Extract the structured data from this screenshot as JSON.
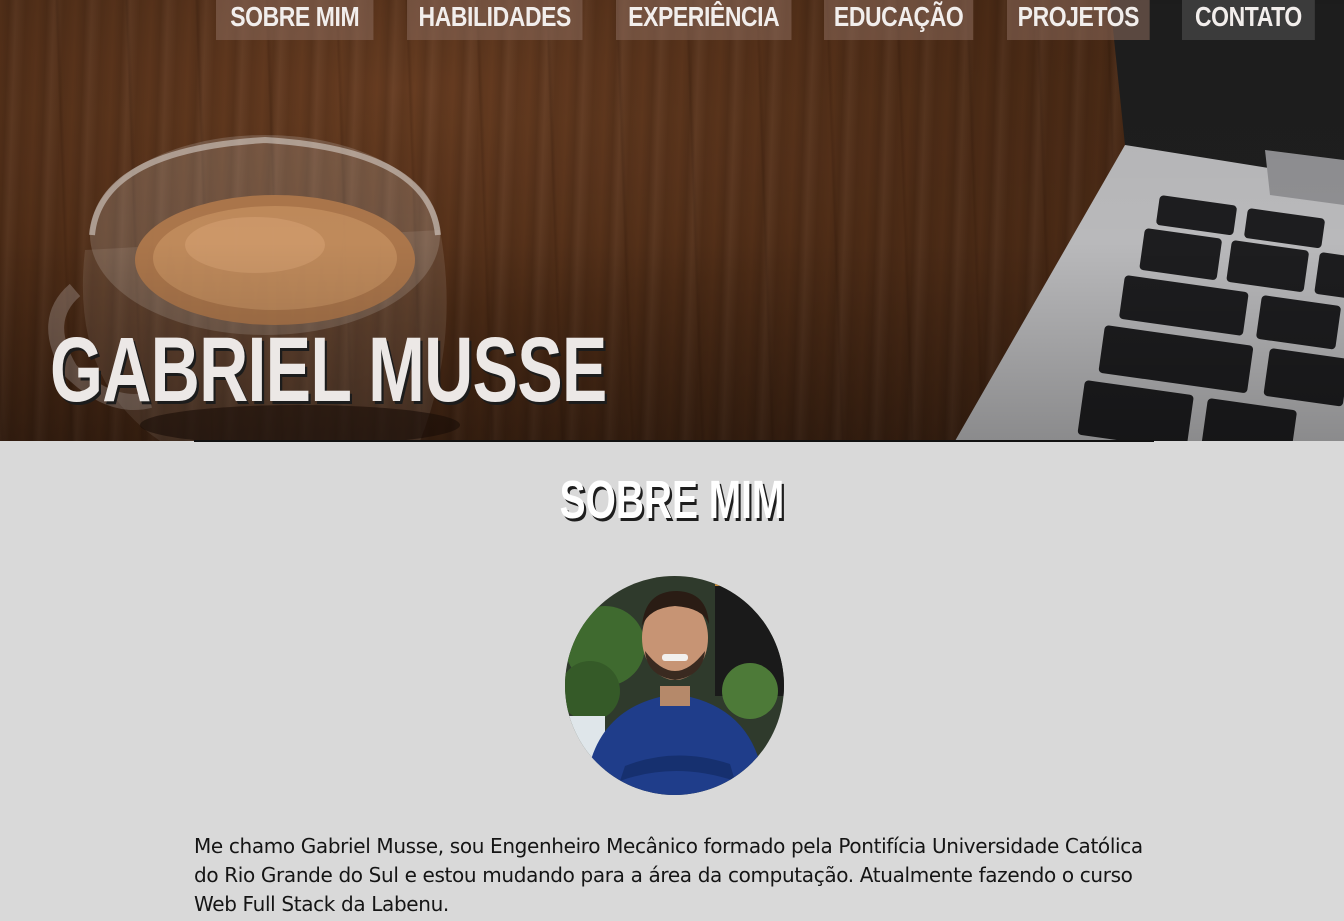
{
  "nav": {
    "items": [
      {
        "label": "SOBRE MIM"
      },
      {
        "label": "HABILIDADES"
      },
      {
        "label": "EXPERIÊNCIA"
      },
      {
        "label": "EDUCAÇÃO"
      },
      {
        "label": "PROJETOS"
      },
      {
        "label": "CONTATO"
      }
    ]
  },
  "hero": {
    "title": "GABRIEL MUSSE"
  },
  "about": {
    "heading": "SOBRE MIM",
    "paragraph": "Me chamo Gabriel Musse, sou Engenheiro Mecânico formado pela Pontifícia Universidade Católica do Rio Grande do Sul e estou mudando para a área da computação. Atualmente fazendo o curso Web Full Stack da Labenu."
  },
  "colors": {
    "background": "#d9d9d9",
    "nav_bg": "#8c6c5c",
    "text": "#151515"
  }
}
